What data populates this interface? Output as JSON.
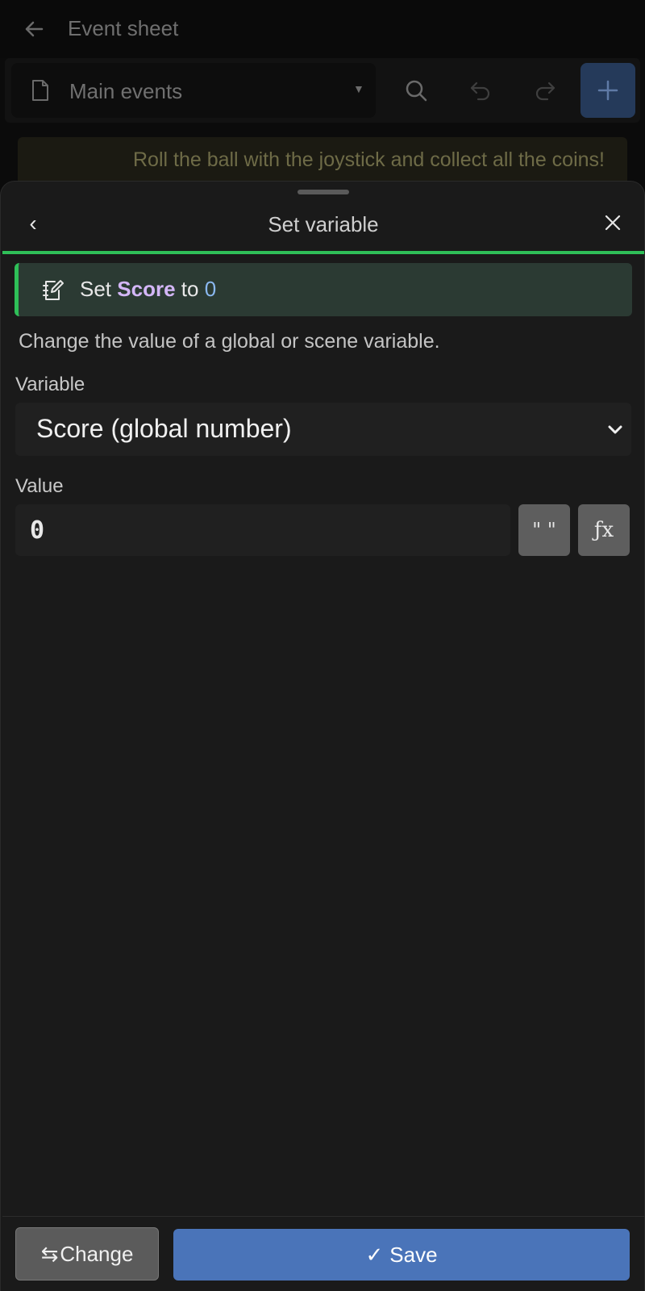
{
  "app": {
    "title": "Event sheet",
    "sheet_name": "Main events",
    "banner_text": "Roll the ball with the joystick and collect all the coins!"
  },
  "icons": {
    "back": "arrow-left-icon",
    "file": "file-icon",
    "search": "search-icon",
    "undo": "undo-icon",
    "redo": "redo-icon",
    "add": "plus-icon",
    "close": "close-icon",
    "edit": "edit-note-icon",
    "chevron": "chevron-down-icon",
    "swap": "swap-icon",
    "check": "check-icon"
  },
  "dialog": {
    "back_glyph": "‹",
    "title": "Set variable",
    "summary": {
      "prefix": "Set",
      "variable": "Score",
      "middle": "to",
      "value": "0"
    },
    "description": "Change the value of a global or scene variable.",
    "variable_label": "Variable",
    "variable_selected": "Score (global number)",
    "value_label": "Value",
    "value": "0",
    "text_mode_glyph": "\" \"",
    "expression_mode_glyph": "ƒx",
    "change_glyph": "⇆",
    "change_label": "Change",
    "save_glyph": "✓",
    "save_label": "Save"
  },
  "colors": {
    "accent_green": "#2fbf58",
    "save_blue": "#4a74b9",
    "variable_token": "#d3b6f7",
    "number_token": "#8ab8f0"
  }
}
